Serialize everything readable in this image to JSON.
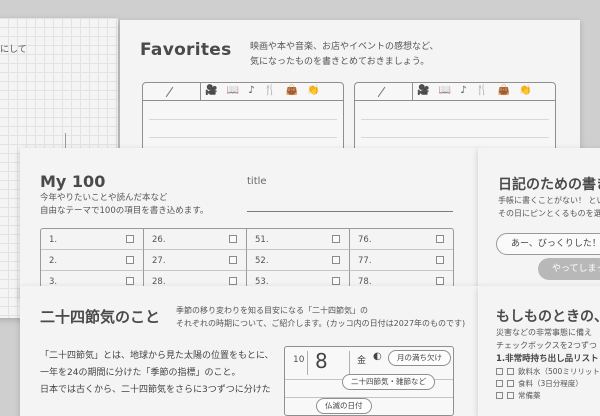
{
  "left_back_page": {
    "fragment": "にして"
  },
  "favorites": {
    "title": "Favorites",
    "description_line1": "映画や本や音楽、お店やイベントの感想など、",
    "description_line2": "気になったものを書きとめておきましょう。",
    "category_icons": [
      "film-camera",
      "book",
      "music-note",
      "fork-knife",
      "bag",
      "hand-clap"
    ],
    "icon_glyphs": "🎥 📖 ♪ 🍴 👜 👏"
  },
  "my100": {
    "title": "My 100",
    "description_line1": "今年やりたいことや読んだ本など",
    "description_line2": "自由なテーマで100の項目を書き込めます。",
    "title_label": "title",
    "columns": [
      [
        "1.",
        "2.",
        "3."
      ],
      [
        "26.",
        "27.",
        "28."
      ],
      [
        "51.",
        "52.",
        "53."
      ],
      [
        "76.",
        "77.",
        "78."
      ]
    ]
  },
  "diary": {
    "title": "日記のための書き",
    "description_line1": "手帳に書くことがない！ とい",
    "description_line2": "その日にピンとくるものを選ん",
    "bubble1": "あー、びっくりした！",
    "bubble2": "やってしまった"
  },
  "nijushi": {
    "title": "二十四節気のこと",
    "description_line1": "季節の移り変わりを知る目安になる「二十四節気」の",
    "description_line2": "それぞれの時期について、ご紹介します。(カッコ内の日付は2027年のものです)",
    "body_line1": "「二十四節気」とは、地球から見た太陽の位置をもとに、",
    "body_line2": "一年を24の期間に分けた「季節の指標」のこと。",
    "body_line3": "日本では古くから、二十四節気をさらに3つずつに分けた",
    "calendar": {
      "month": "10",
      "day": "8",
      "weekday": "金",
      "moon": "◐"
    },
    "callout1": "月の満ち欠け",
    "callout2": "二十四節気・雑節など",
    "callout3": "仏滅の日付"
  },
  "moshimo": {
    "title": "もしものときの、",
    "description_line1": "災害などの非常事態に備え",
    "description_line2": "チェックボックスを2つずつ",
    "subheading": "1.非常時持ち出し品リスト",
    "item1": "飲料水（500ミリリットル",
    "item2": "食料（3日分程度）",
    "item3": "常備薬"
  }
}
